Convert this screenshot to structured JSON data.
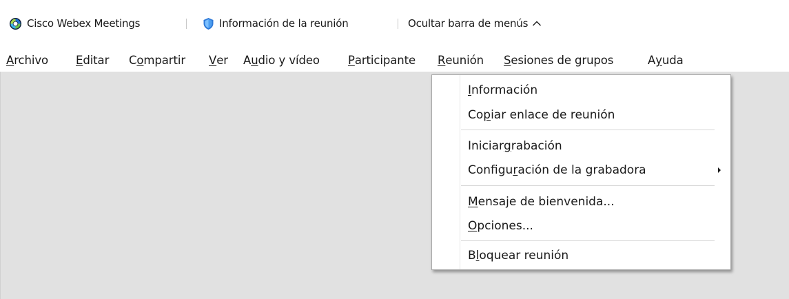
{
  "titlebar": {
    "app_name": "Cisco Webex Meetings",
    "meeting_info_label": "Información de la reunión",
    "hide_menubar_label": "Ocultar barra de menús",
    "icons": [
      "webex-logo-icon",
      "shield-icon",
      "chevron-up-icon"
    ]
  },
  "menubar": {
    "items": [
      {
        "pre": "",
        "mn": "A",
        "post": "rchivo"
      },
      {
        "pre": "",
        "mn": "E",
        "post": "ditar"
      },
      {
        "pre": "C",
        "mn": "o",
        "post": "mpartir"
      },
      {
        "pre": "",
        "mn": "V",
        "post": "er"
      },
      {
        "pre": "A",
        "mn": "u",
        "post": "dio y vídeo"
      },
      {
        "pre": "",
        "mn": "P",
        "post": "articipante"
      },
      {
        "pre": "",
        "mn": "R",
        "post": "eunión"
      },
      {
        "pre": "",
        "mn": "S",
        "post": "esiones de grupos"
      },
      {
        "pre": "A",
        "mn": "y",
        "post": "uda"
      }
    ],
    "open_menu": "Reunión"
  },
  "dropdown": {
    "items": [
      {
        "pre": "",
        "mn": "I",
        "post": "nformación"
      },
      {
        "pre": "Co",
        "mn": "p",
        "post": "iar enlace de reunión"
      },
      {
        "pre": "Iniciar ",
        "mn": "g",
        "post": "rabación"
      },
      {
        "pre": "Configu",
        "mn": "r",
        "post": "ación de la grabadora"
      },
      {
        "pre": "",
        "mn": "M",
        "post": "ensaje de bienvenida..."
      },
      {
        "pre": "",
        "mn": "O",
        "post": "pciones..."
      },
      {
        "pre": "B",
        "mn": "l",
        "post": "oquear reunión"
      }
    ],
    "submenu_item": "Configuración de la grabadora"
  },
  "colors": {
    "content_bg": "#e1e1e1",
    "webex_blue": "#1f6fd1",
    "webex_green": "#6cc04a",
    "shield_blue": "#4a90e2"
  }
}
